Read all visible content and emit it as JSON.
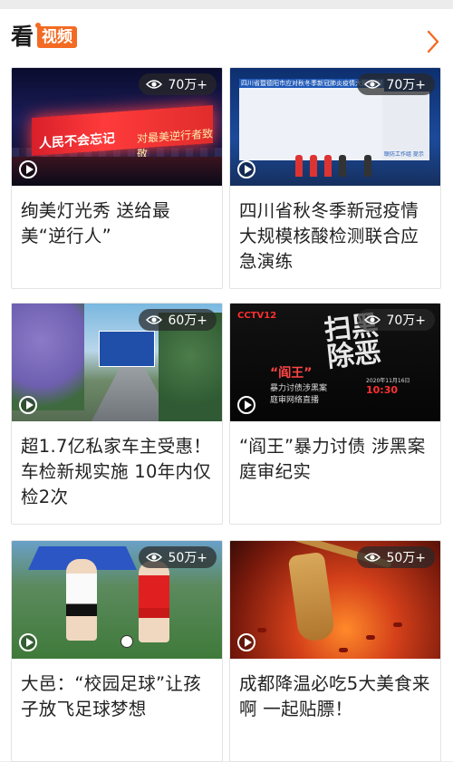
{
  "header": {
    "logo_text": "看",
    "section_label": "视频",
    "more_icon": "chevron-right-icon"
  },
  "colors": {
    "brand_orange": "#f36b23",
    "card_border": "#e3e3e3",
    "title_text": "#222222"
  },
  "cards": [
    {
      "title": "绚美灯光秀 送给最美“逆行人”",
      "views": "70万+",
      "thumbnail": {
        "overlay_left": "人民不会忘记",
        "overlay_right": "对最美逆行者致敬"
      }
    },
    {
      "title": "四川省秋冬季新冠疫情大规模核酸检测联合应急演练",
      "views": "70万+",
      "thumbnail": {
        "screen_heading": "四川省暨德阳市应对秋冬季新冠肺炎疫情大规模核酸检测联合演练",
        "screen_caption": "联防工作组 提示"
      }
    },
    {
      "title": "超1.7亿私家车主受惠！车检新规实施 10年内仅检2次",
      "views": "60万+",
      "thumbnail": {}
    },
    {
      "title": "“阎王”暴力讨债 涉黑案庭审纪实",
      "views": "70万+",
      "thumbnail": {
        "channel": "CCTV12",
        "big_text": "扫黑除恶",
        "red_text": "“阎王”",
        "sub_line1": "暴力讨债涉黑案",
        "sub_line2": "庭审网络直播",
        "date": "2020年11月16日",
        "time": "10:30"
      }
    },
    {
      "title": "大邑：“校园足球”让孩子放飞足球梦想",
      "views": "50万+",
      "thumbnail": {}
    },
    {
      "title": "成都降温必吃5大美食来啊 一起贴膘！",
      "views": "50万+",
      "thumbnail": {}
    }
  ]
}
